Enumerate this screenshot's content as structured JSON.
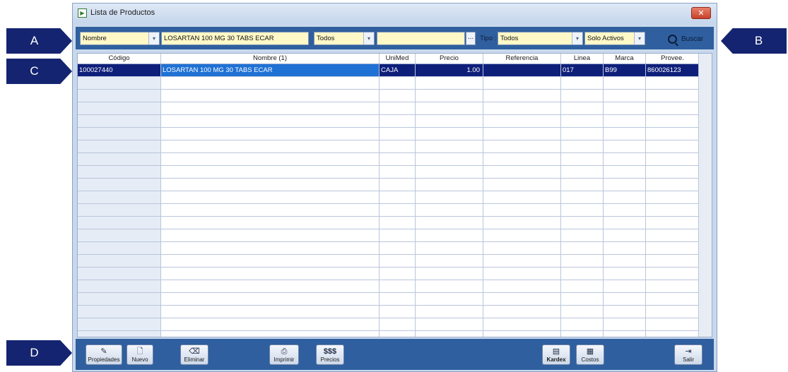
{
  "callouts": {
    "a": "A",
    "b": "B",
    "c": "C",
    "d": "D"
  },
  "window": {
    "title": "Lista de Productos",
    "close_glyph": "✕"
  },
  "filters": {
    "field_select": "Nombre",
    "search_value": "LOSARTAN 100 MG 30 TABS ECAR",
    "scope_select": "Todos",
    "extra_value": "",
    "ellipsis": "...",
    "tipo_label": "Tipo :",
    "tipo_select": "Todos",
    "estado_select": "Solo Activos",
    "buscar_label": "Buscar"
  },
  "grid": {
    "headers": [
      "Código",
      "Nombre (1)",
      "UniMed",
      "Precio",
      "Referencia",
      "Linea",
      "Marca",
      "Provee."
    ],
    "rows": [
      {
        "codigo": "100027440",
        "nombre": "LOSARTAN 100 MG 30 TABS ECAR",
        "unimed": "CAJA",
        "precio": "1.00",
        "referencia": "",
        "linea": "017",
        "marca": "B99",
        "provee": "860026123"
      }
    ]
  },
  "toolbar": {
    "propiedades": "Propiedades",
    "nuevo": "Nuevo",
    "eliminar": "Eliminar",
    "imprimir": "Imprimir",
    "precios_icon": "$$$",
    "precios": "Precios",
    "kardex": "Kardex",
    "costos": "Costos",
    "salir": "Salir"
  },
  "colors": {
    "selection_row": "#0e1f7a",
    "selection_cell": "#1f71d4",
    "toolbar": "#2f5f9e",
    "callout": "#142470"
  }
}
